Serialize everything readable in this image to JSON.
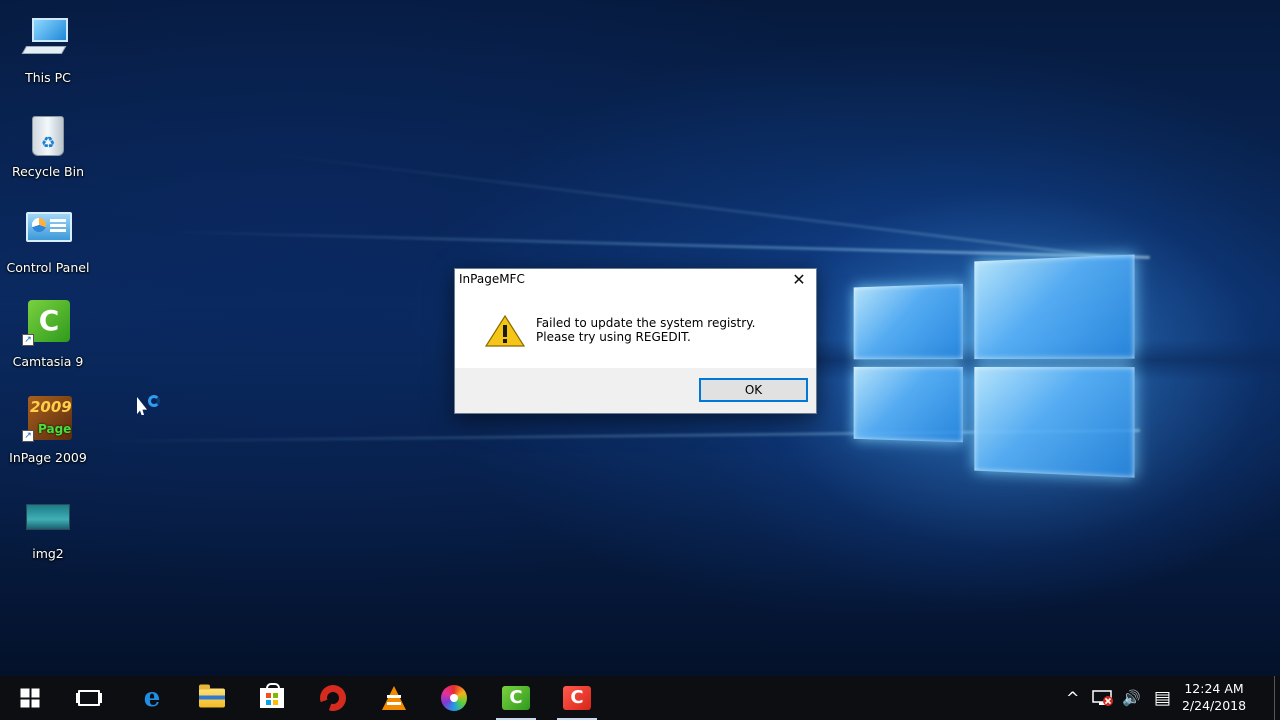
{
  "desktop": {
    "icons": [
      {
        "label": "This PC",
        "icon": "computer-icon"
      },
      {
        "label": "Recycle Bin",
        "icon": "recycle-bin-icon"
      },
      {
        "label": "Control Panel",
        "icon": "control-panel-icon"
      },
      {
        "label": "Camtasia 9",
        "icon": "camtasia-icon"
      },
      {
        "label": "InPage 2009",
        "icon": "inpage-icon",
        "logo_text": {
          "year": "2009",
          "brand": "Page"
        }
      },
      {
        "label": "img2",
        "icon": "image-file-icon"
      }
    ]
  },
  "dialog": {
    "title": "InPageMFC",
    "close_glyph": "✕",
    "icon": "warning-icon",
    "message_line1": "Failed to update the system registry.",
    "message_line2": "Please try using REGEDIT.",
    "ok_label": "OK"
  },
  "taskbar": {
    "pinned": [
      {
        "name": "start",
        "icon": "windows-start-icon"
      },
      {
        "name": "task-view",
        "icon": "task-view-icon"
      },
      {
        "name": "edge",
        "icon": "edge-browser-icon"
      },
      {
        "name": "file-explorer",
        "icon": "folder-icon"
      },
      {
        "name": "store",
        "icon": "store-icon"
      },
      {
        "name": "ccleaner",
        "icon": "ccleaner-icon"
      },
      {
        "name": "vlc",
        "icon": "vlc-icon"
      },
      {
        "name": "color-app",
        "icon": "color-wheel-icon"
      },
      {
        "name": "camtasia-recorder",
        "icon": "camtasia-green-icon",
        "active": true
      },
      {
        "name": "camtasia-red",
        "icon": "camtasia-red-icon",
        "active": true
      }
    ],
    "glyphs": {
      "edge": "e",
      "camtasia": "C"
    },
    "tray": {
      "chevron": "^",
      "speaker": "🔊",
      "notifications": "▤"
    },
    "time": "12:24 AM",
    "date": "2/24/2018"
  },
  "colors": {
    "accent": "#0078d7",
    "taskbar": "#0c0e12",
    "warning": "#f5c518"
  }
}
